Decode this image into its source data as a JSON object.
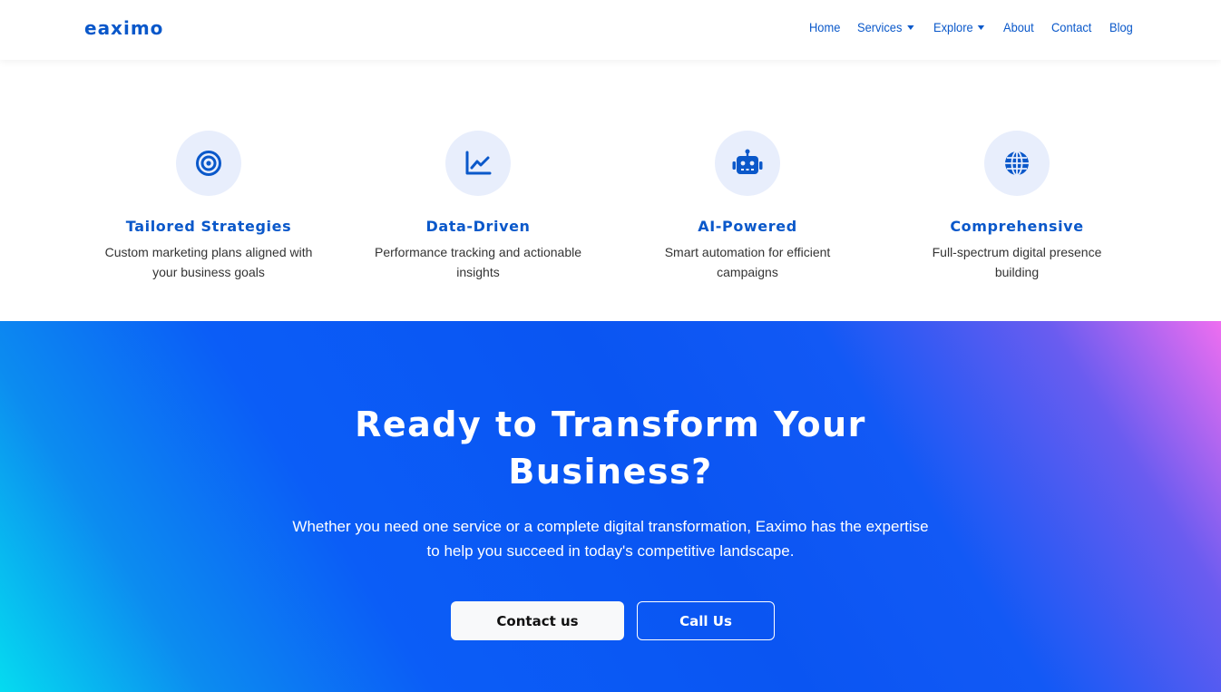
{
  "brand": {
    "name": "eaximo"
  },
  "nav": {
    "items": [
      {
        "label": "Home",
        "dropdown": false
      },
      {
        "label": "Services",
        "dropdown": true
      },
      {
        "label": "Explore",
        "dropdown": true
      },
      {
        "label": "About",
        "dropdown": false
      },
      {
        "label": "Contact",
        "dropdown": false
      },
      {
        "label": "Blog",
        "dropdown": false
      }
    ]
  },
  "features": [
    {
      "icon": "target-icon",
      "title": "Tailored Strategies",
      "desc": "Custom marketing plans aligned with your business goals"
    },
    {
      "icon": "line-chart-icon",
      "title": "Data-Driven",
      "desc": "Performance tracking and actionable insights"
    },
    {
      "icon": "robot-icon",
      "title": "AI-Powered",
      "desc": "Smart automation for efficient campaigns"
    },
    {
      "icon": "globe-icon",
      "title": "Comprehensive",
      "desc": "Full-spectrum digital presence building"
    }
  ],
  "cta": {
    "title": "Ready to Transform Your Business?",
    "text": "Whether you need one service or a complete digital transformation, Eaximo has the expertise to help you succeed in today's competitive landscape.",
    "primary_label": "Contact us",
    "secondary_label": "Call Us"
  },
  "colors": {
    "accent": "#0a58ca",
    "icon_bg": "#e8eefc",
    "gradient_start": "#05dbf0",
    "gradient_mid": "#0a55f2",
    "gradient_end": "#ee6ef0"
  }
}
